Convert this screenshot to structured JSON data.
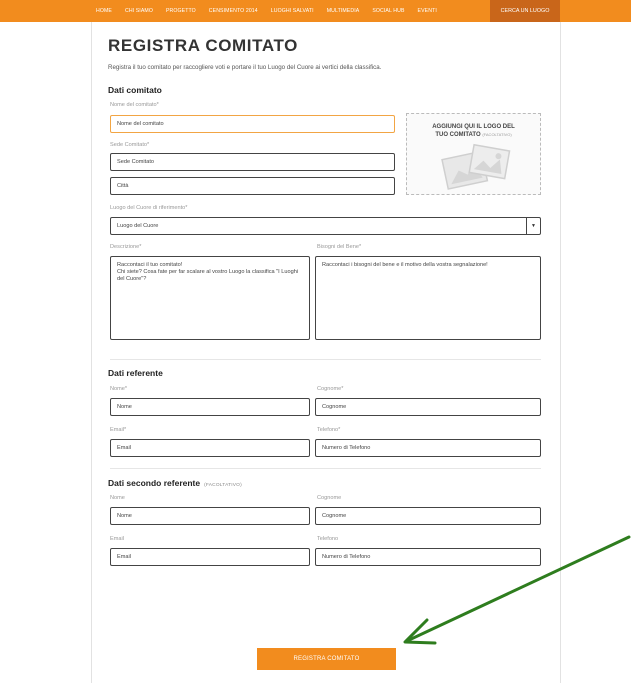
{
  "nav": {
    "items": [
      "HOME",
      "CHI SIAMO",
      "PROGETTO",
      "CENSIMENTO 2014",
      "LUOGHI SALVATI",
      "MULTIMEDIA",
      "SOCIAL HUB",
      "EVENTI"
    ],
    "search_label": "CERCA UN LUOGO"
  },
  "page": {
    "title": "REGISTRA COMITATO",
    "subtitle": "Registra il tuo comitato per raccogliere voti e portare il tuo Luogo del Cuore ai vertici della classifica."
  },
  "dati_comitato": {
    "heading": "Dati comitato",
    "nome_label": "Nome del comitato*",
    "nome_value": "Nome del comitato",
    "sede_label": "Sede Comitato*",
    "sede_value": "Sede Comitato",
    "citta_value": "Città",
    "luogo_label": "Luogo del Cuore di riferimento*",
    "luogo_value": "Luogo del Cuore",
    "descrizione_label": "Descrizione*",
    "descrizione_value": "Raccontaci il tuo comitato!\nChi siete? Cosa fate per far scalare al vostro Luogo la classifica \"I Luoghi del Cuore\"?",
    "bisogni_label": "Bisogni del Bene*",
    "bisogni_value": "Raccontaci i bisogni del bene e il motivo della vostra segnalazione!",
    "logo_line1": "AGGIUNGI QUI IL LOGO DEL",
    "logo_line2": "TUO COMITATO",
    "logo_optional": "(FACOLTATIVO)"
  },
  "dati_referente": {
    "heading": "Dati referente",
    "nome_label": "Nome*",
    "nome_value": "Nome",
    "cognome_label": "Cognome*",
    "cognome_value": "Cognome",
    "email_label": "Email*",
    "email_value": "Email",
    "telefono_label": "Telefono*",
    "telefono_value": "Numero di Telefono"
  },
  "dati_secondo": {
    "heading": "Dati secondo referente",
    "optional": "(FACOLTATIVO)",
    "nome_label": "Nome",
    "nome_value": "Nome",
    "cognome_label": "Cognome",
    "cognome_value": "Cognome",
    "email_label": "Email",
    "email_value": "Email",
    "telefono_label": "Telefono",
    "telefono_value": "Numero di Telefono"
  },
  "submit_label": "REGISTRA COMITATO",
  "colors": {
    "brand_orange": "#f28c1e",
    "nav_active": "#c9661a",
    "focus_border": "#f2a544",
    "annotation_arrow": "#2e7d1e"
  }
}
